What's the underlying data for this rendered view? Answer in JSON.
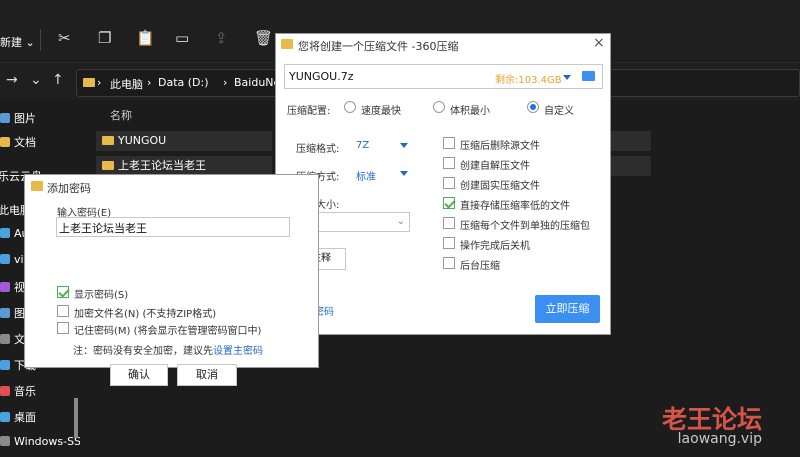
{
  "explorer": {
    "toolbar": {
      "new_label": "新建",
      "new_arrow": "⌄"
    },
    "address": {
      "crumbs": [
        "此电脑",
        "Data (D:)",
        "BaiduNetdis"
      ],
      "separator": "›"
    },
    "column_header": "名称",
    "sidebar": [
      {
        "label": "图片",
        "color": "#5b9bd5"
      },
      {
        "label": "文档",
        "color": "#e8b84a"
      },
      {
        "label": "乐云云盘",
        "color": "#e8b84a"
      },
      {
        "label": "此电脑",
        "color": "#4aa3df"
      },
      {
        "label": "Auto",
        "color": "#4aa3df"
      },
      {
        "label": "vivo",
        "color": "#4aa3df"
      },
      {
        "label": "视频",
        "color": "#a05bd5"
      },
      {
        "label": "图片",
        "color": "#5b9bd5"
      },
      {
        "label": "文档",
        "color": "#8a8a8a"
      },
      {
        "label": "下载",
        "color": "#4aa3df"
      },
      {
        "label": "音乐",
        "color": "#e05050"
      },
      {
        "label": "桌面",
        "color": "#4aa3df"
      },
      {
        "label": "Windows-SSD",
        "color": "#8a8a8a"
      }
    ],
    "files": [
      {
        "name": "YUNGOU"
      },
      {
        "name": "上老王论坛当老王"
      }
    ]
  },
  "compress_dialog": {
    "title": "您将创建一个压缩文件 -360压缩",
    "close": "×",
    "filename": "YUNGOU.7z",
    "remaining": "剩余:103.4GB",
    "config_label": "压缩配置:",
    "modes": [
      {
        "label": "速度最快",
        "selected": false
      },
      {
        "label": "体积最小",
        "selected": false
      },
      {
        "label": "自定义",
        "selected": true
      }
    ],
    "format_label": "压缩格式:",
    "format_value": "7Z",
    "method_label": "压缩方式:",
    "method_value": "标准",
    "split_label": "分卷大小:",
    "comment_label": "注释",
    "password_link": "密码",
    "options": [
      {
        "label": "压缩后删除源文件",
        "checked": false
      },
      {
        "label": "创建自解压文件",
        "checked": false
      },
      {
        "label": "创建固实压缩文件",
        "checked": false
      },
      {
        "label": "直接存储压缩率低的文件",
        "checked": true
      },
      {
        "label": "压缩每个文件到单独的压缩包",
        "checked": false
      },
      {
        "label": "操作完成后关机",
        "checked": false
      },
      {
        "label": "后台压缩",
        "checked": false
      }
    ],
    "start_button": "立即压缩"
  },
  "password_dialog": {
    "title": "添加密码",
    "input_label": "输入密码(E)",
    "input_value": "上老王论坛当老王",
    "options": [
      {
        "label": "显示密码(S)",
        "checked": true
      },
      {
        "label": "加密文件名(N) (不支持ZIP格式)",
        "checked": false
      },
      {
        "label": "记住密码(M) (将会显示在管理密码窗口中)",
        "checked": false
      }
    ],
    "note_prefix": "注：密码没有安全加密，建议先",
    "note_link": "设置主密码",
    "ok_button": "确认",
    "cancel_button": "取消"
  },
  "watermark": {
    "title": "老王论坛",
    "url": "laowang.vip"
  }
}
